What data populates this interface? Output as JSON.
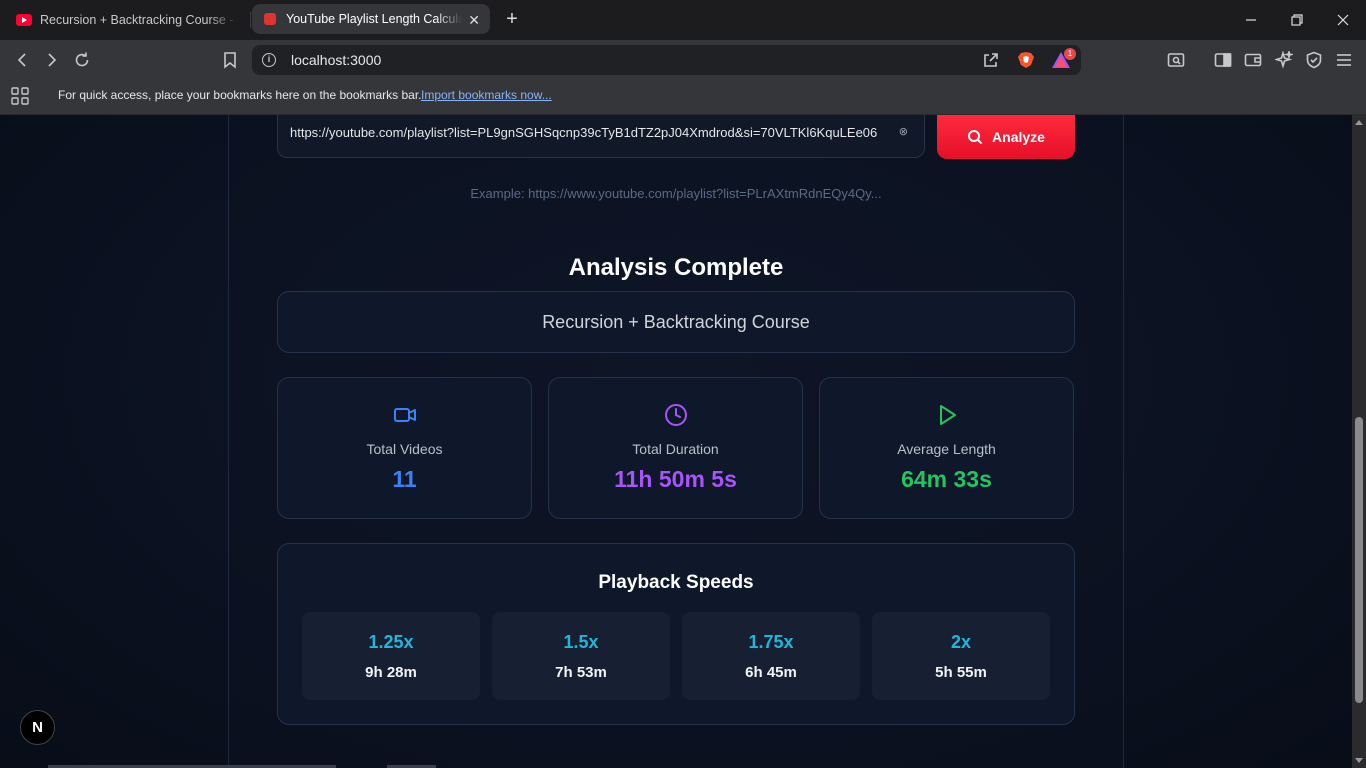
{
  "browser": {
    "tabs": [
      {
        "title": "Recursion + Backtracking Course - YouTube",
        "active": false
      },
      {
        "title": "YouTube Playlist Length Calculator",
        "active": true
      }
    ],
    "address": "localhost:3000",
    "bookmarks_message": "For quick access, place your bookmarks here on the bookmarks bar.",
    "bookmarks_link": "Import bookmarks now...",
    "rewards_badge": "1"
  },
  "form": {
    "url_value": "https://youtube.com/playlist?list=PL9gnSGHSqcnp39cTyB1dTZ2pJ04Xmdrod&si=70VLTKl6KquLEe06",
    "clear_glyph": "⊗",
    "analyze_label": "Analyze",
    "example": "Example: https://www.youtube.com/playlist?list=PLrAXtmRdnEQy4Qy..."
  },
  "result": {
    "heading": "Analysis Complete",
    "playlist_name": "Recursion + Backtracking Course",
    "stats": [
      {
        "label": "Total Videos",
        "value": "11",
        "icon": "video-icon",
        "color": "#3b82f6"
      },
      {
        "label": "Total Duration",
        "value": "11h 50m 5s",
        "icon": "clock-icon",
        "color": "#a855f7"
      },
      {
        "label": "Average Length",
        "value": "64m 33s",
        "icon": "play-icon",
        "color": "#22c55e"
      }
    ],
    "speeds_title": "Playback Speeds",
    "speeds": [
      {
        "rate": "1.25x",
        "time": "9h 28m"
      },
      {
        "rate": "1.5x",
        "time": "7h 53m"
      },
      {
        "rate": "1.75x",
        "time": "6h 45m"
      },
      {
        "rate": "2x",
        "time": "5h 55m"
      }
    ]
  },
  "dev_badge": "N"
}
